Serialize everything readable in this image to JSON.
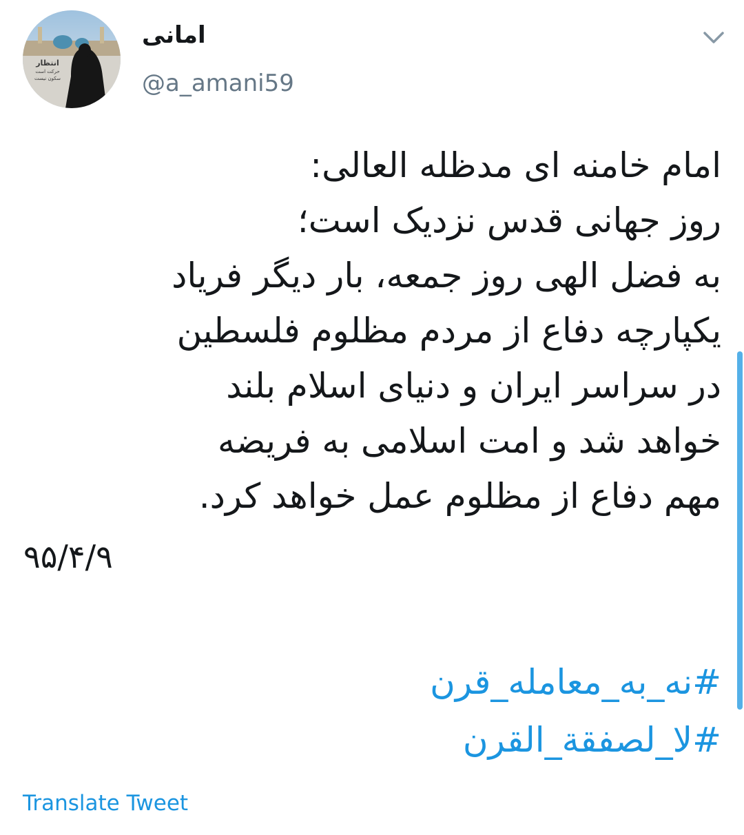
{
  "user": {
    "display_name": "امانی",
    "handle": "@a_amani59",
    "avatar_caption_lines": [
      "انتظار",
      "حرکت است",
      "سکون نیست"
    ]
  },
  "tweet": {
    "lines": [
      "امام خامنه ای مدظله العالی:",
      "روز جهانی قدس نزدیک است؛",
      "به فضل الهی روز جمعه، بار دیگر فریاد",
      "یکپارچه دفاع از مردم مظلوم فلسطین",
      "در سراسر ایران و دنیای اسلام بلند",
      "خواهد شد و امت اسلامی به فریضه",
      "مهم دفاع از مظلوم عمل خواهد کرد."
    ],
    "date": "۹۵/۴/۹",
    "hashtags": [
      "#نه_به_معامله_قرن",
      "#لا_لصفقة_القرن"
    ],
    "translate_label": "Translate Tweet"
  },
  "colors": {
    "text": "#14171a",
    "secondary": "#657786",
    "link": "#1b95e0",
    "background": "#ffffff"
  },
  "icons": {
    "menu": "chevron-down-icon",
    "avatar": "avatar"
  }
}
